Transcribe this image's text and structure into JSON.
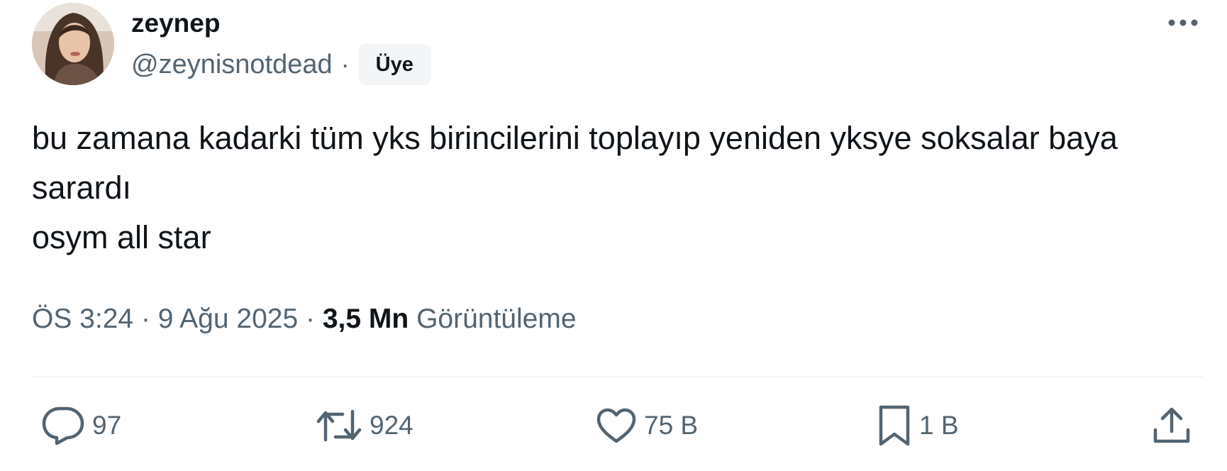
{
  "author": {
    "display_name": "zeynep",
    "handle": "@zeynisnotdead",
    "badge": "Üye"
  },
  "tweet": {
    "text": "bu zamana kadarki tüm yks birincilerini toplayıp yeniden yksye soksalar baya sarardı\nosym all star"
  },
  "meta": {
    "time": "ÖS 3:24",
    "date": "9 Ağu 2025",
    "views_count": "3,5 Mn",
    "views_label": "Görüntüleme",
    "separator": "·"
  },
  "actions": {
    "replies": "97",
    "reposts": "924",
    "likes": "75 B",
    "bookmarks": "1 B"
  },
  "icons": {
    "more": "more-horizontal-icon",
    "reply": "reply-icon",
    "repost": "repost-icon",
    "like": "heart-icon",
    "bookmark": "bookmark-icon",
    "share": "share-icon"
  },
  "colors": {
    "text": "#0f1419",
    "secondary": "#536471",
    "badge_bg": "#f3f5f6",
    "divider": "#eff3f4"
  }
}
